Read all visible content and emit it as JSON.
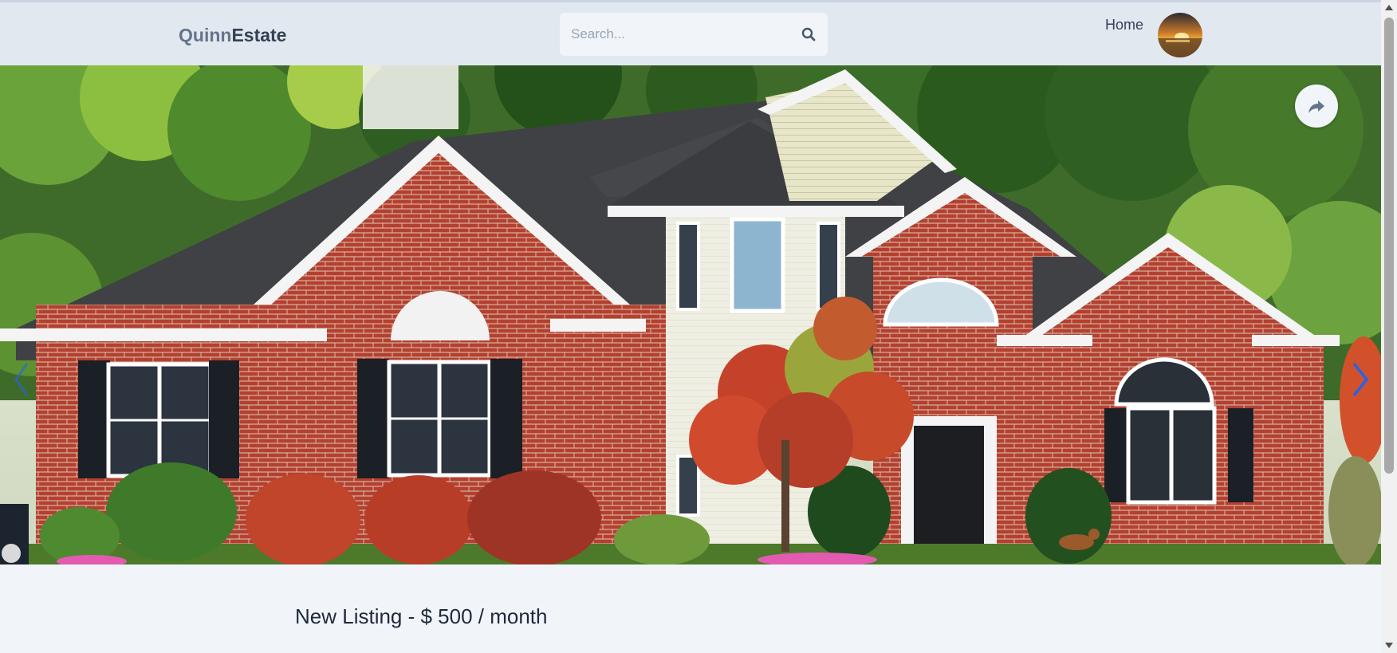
{
  "header": {
    "logo_part1": "Quinn",
    "logo_part2": "Estate",
    "search_placeholder": "Search...",
    "search_icon": "search-icon",
    "nav_home": "Home",
    "avatar_icon": "sunset-avatar"
  },
  "hero": {
    "image": "red-brick-house-photo",
    "share_icon": "share-icon",
    "prev_icon": "chevron-left-icon",
    "next_icon": "chevron-right-icon"
  },
  "listing": {
    "title": "New Listing - $ 500 / month"
  },
  "colors": {
    "header_bg": "#e2e8f0",
    "logo_light": "#64748b",
    "logo_dark": "#334155",
    "page_bg": "#f1f5f9",
    "brick": "#b03a2e"
  }
}
